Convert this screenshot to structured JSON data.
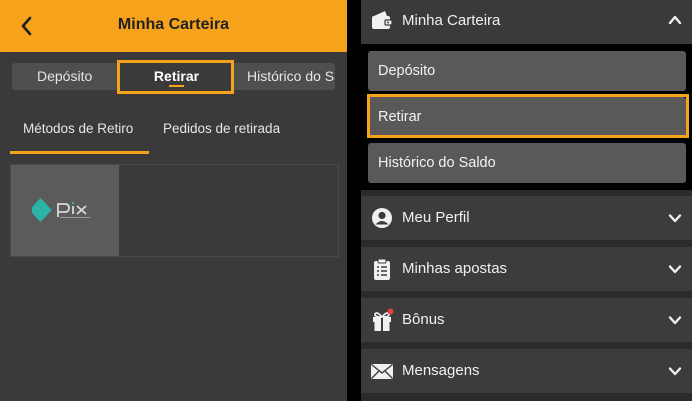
{
  "left": {
    "header": {
      "title": "Minha Carteira",
      "back_icon": "chevron-left-icon"
    },
    "tabs": [
      {
        "label": "Depósito"
      },
      {
        "label": "Retirar"
      },
      {
        "label": "Histórico do Saldo"
      }
    ],
    "subtabs": [
      {
        "label": "Métodos de Retiro"
      },
      {
        "label": "Pedidos de retirada"
      }
    ],
    "methods": [
      {
        "icon": "pix-logo"
      }
    ]
  },
  "right": {
    "open_section": {
      "label": "Minha Carteira",
      "icon": "wallet-icon",
      "items": [
        {
          "label": "Depósito"
        },
        {
          "label": "Retirar"
        },
        {
          "label": "Histórico do Saldo"
        }
      ]
    },
    "sections": [
      {
        "label": "Meu Perfil",
        "icon": "user-icon"
      },
      {
        "label": "Minhas apostas",
        "icon": "clipboard-icon"
      },
      {
        "label": "Bônus",
        "icon": "gift-icon"
      },
      {
        "label": "Mensagens",
        "icon": "envelope-icon"
      }
    ]
  },
  "colors": {
    "accent": "#f7a21b",
    "panel": "#3a3a3a",
    "tab_bar": "#4f4f4f",
    "sub_item": "#595959",
    "notification_dot": "#e8413a"
  }
}
